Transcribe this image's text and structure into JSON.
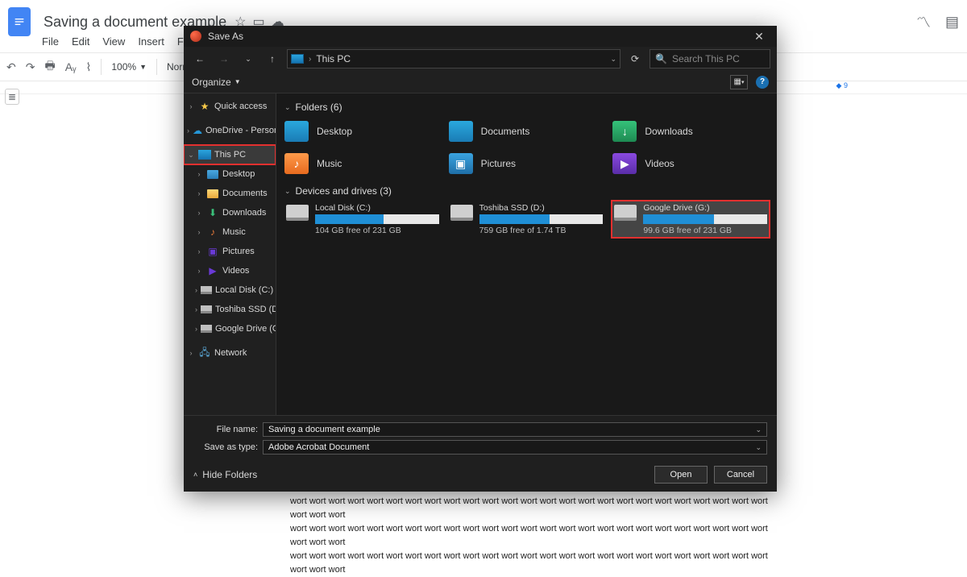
{
  "gdocs": {
    "title": "Saving a document example",
    "menus": [
      "File",
      "Edit",
      "View",
      "Insert",
      "Format"
    ],
    "zoom": "100%",
    "style": "Normal t",
    "ruler_end": "9",
    "body_line": "wort wort wort wort wort wort wort wort wort wort wort wort wort wort wort wort wort wort wort wort wort wort wort wort wort wort wort wort"
  },
  "saveas": {
    "title": "Save As",
    "breadcrumb": "This PC",
    "search_placeholder": "Search This PC",
    "organize": "Organize",
    "tree": {
      "quick": "Quick access",
      "onedrive": "OneDrive - Personal",
      "thispc": "This PC",
      "children": [
        "Desktop",
        "Documents",
        "Downloads",
        "Music",
        "Pictures",
        "Videos",
        "Local Disk (C:)",
        "Toshiba SSD (D:)",
        "Google Drive (G:)"
      ],
      "network": "Network"
    },
    "folders_header": "Folders (6)",
    "folders": [
      "Desktop",
      "Documents",
      "Downloads",
      "Music",
      "Pictures",
      "Videos"
    ],
    "drives_header": "Devices and drives (3)",
    "drives": [
      {
        "name": "Local Disk (C:)",
        "free": "104 GB free of 231 GB",
        "fill": 55
      },
      {
        "name": "Toshiba SSD (D:)",
        "free": "759 GB free of 1.74 TB",
        "fill": 57
      },
      {
        "name": "Google Drive (G:)",
        "free": "99.6 GB free of 231 GB",
        "fill": 57
      }
    ],
    "filename_label": "File name:",
    "filename_value": "Saving a document example",
    "type_label": "Save as type:",
    "type_value": "Adobe Acrobat Document",
    "hide_folders": "Hide Folders",
    "open": "Open",
    "cancel": "Cancel"
  }
}
